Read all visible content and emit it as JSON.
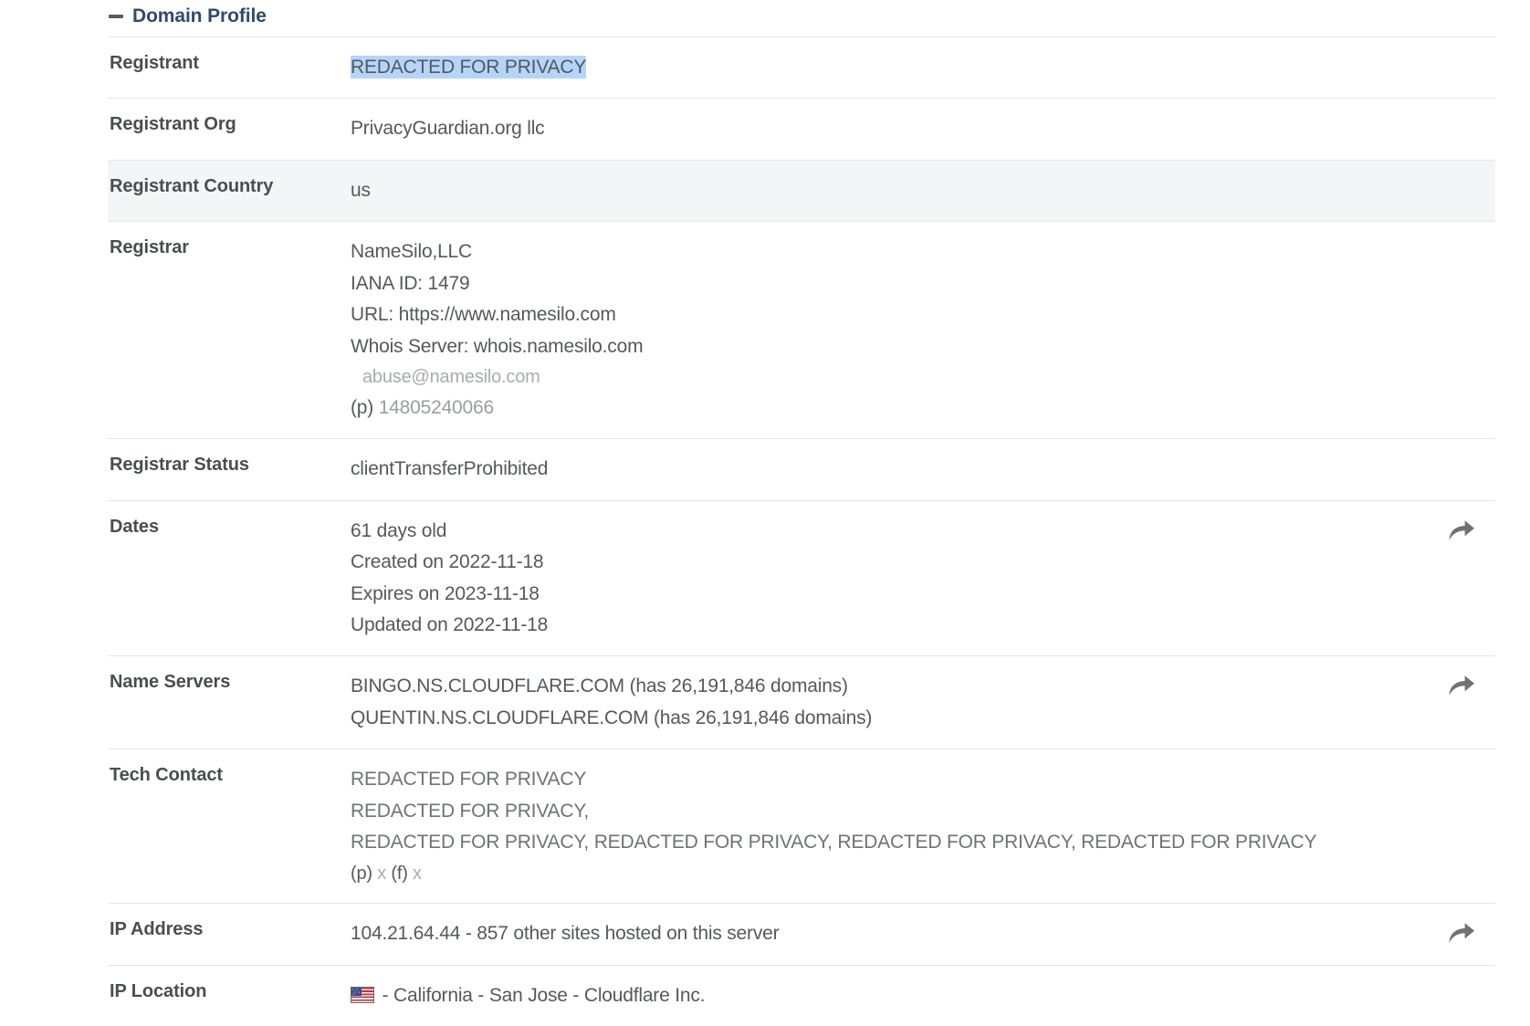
{
  "header": {
    "title": "Domain Profile",
    "collapse_icon": "minus-icon"
  },
  "rows": [
    {
      "label": "Registrant",
      "lines": [
        {
          "text": "REDACTED FOR PRIVACY",
          "style": "selected"
        }
      ],
      "shaded": false,
      "action": null
    },
    {
      "label": "Registrant Org",
      "lines": [
        {
          "text": "PrivacyGuardian.org llc",
          "style": "normal"
        }
      ],
      "shaded": false,
      "action": null
    },
    {
      "label": "Registrant Country",
      "lines": [
        {
          "text": "us",
          "style": "normal"
        }
      ],
      "shaded": true,
      "action": null
    },
    {
      "label": "Registrar",
      "lines": [
        {
          "text": "NameSilo,LLC",
          "style": "normal"
        },
        {
          "text": "IANA ID: 1479",
          "style": "normal"
        },
        {
          "text": "URL: https://www.namesilo.com",
          "style": "normal"
        },
        {
          "text": "Whois Server: whois.namesilo.com",
          "style": "normal"
        },
        {
          "text": "abuse@namesilo.com",
          "style": "muted-indent"
        },
        {
          "text": "(p) 14805240066",
          "style": "phone"
        }
      ],
      "shaded": false,
      "action": null
    },
    {
      "label": "Registrar Status",
      "lines": [
        {
          "text": "clientTransferProhibited",
          "style": "normal"
        }
      ],
      "shaded": false,
      "action": null
    },
    {
      "label": "Dates",
      "lines": [
        {
          "text": "61 days old",
          "style": "normal"
        },
        {
          "text": "Created on 2022-11-18",
          "style": "normal"
        },
        {
          "text": "Expires on 2023-11-18",
          "style": "normal"
        },
        {
          "text": "Updated on 2022-11-18",
          "style": "normal"
        }
      ],
      "shaded": false,
      "action": "share-icon"
    },
    {
      "label": "Name Servers",
      "lines": [
        {
          "text": "BINGO.NS.CLOUDFLARE.COM (has 26,191,846 domains)",
          "style": "normal"
        },
        {
          "text": "QUENTIN.NS.CLOUDFLARE.COM (has 26,191,846 domains)",
          "style": "normal"
        }
      ],
      "shaded": false,
      "action": "share-icon"
    },
    {
      "label": "Tech Contact",
      "lines": [
        {
          "text": "REDACTED FOR PRIVACY",
          "style": "tech"
        },
        {
          "text": "REDACTED FOR PRIVACY,",
          "style": "tech"
        },
        {
          "text": "REDACTED FOR PRIVACY, REDACTED FOR PRIVACY, REDACTED FOR PRIVACY, REDACTED FOR PRIVACY",
          "style": "tech-wrap"
        },
        {
          "text": "(p) x  (f) x",
          "style": "contact-xs"
        }
      ],
      "shaded": false,
      "action": null
    },
    {
      "label": "IP Address",
      "lines": [
        {
          "text": "104.21.64.44 - 857 other sites hosted on this server",
          "style": "normal"
        }
      ],
      "shaded": false,
      "action": "share-icon"
    },
    {
      "label": "IP Location",
      "lines": [
        {
          "text": " - California - San Jose - Cloudflare Inc.",
          "style": "flag"
        }
      ],
      "shaded": false,
      "action": null
    }
  ],
  "colors": {
    "link": "#2f4a6d",
    "label": "#4a4d52",
    "value": "#55585e",
    "muted": "#a8abaf",
    "selection": "#b4d5fb",
    "row_shade": "#f4f5f6",
    "border": "#e3e5e8"
  }
}
